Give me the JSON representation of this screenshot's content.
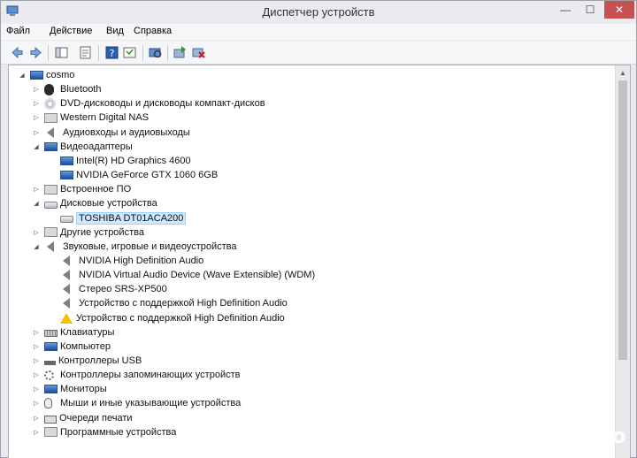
{
  "window": {
    "title": "Диспетчер устройств",
    "min_glyph": "—",
    "max_glyph": "☐",
    "close_glyph": "✕"
  },
  "menu": [
    "Файл",
    "Действие",
    "Вид",
    "Справка"
  ],
  "toolbar": [
    "back-icon",
    "forward-icon",
    "show-hide-tree-icon",
    "properties-icon",
    "help-icon",
    "action-icon",
    "scan-hardware-icon",
    "update-driver-icon",
    "uninstall-icon"
  ],
  "tree": [
    {
      "level": 0,
      "arrow": "◢",
      "icon": "computer-icon",
      "label": "cosmo"
    },
    {
      "level": 1,
      "arrow": "▷",
      "icon": "bluetooth-icon",
      "label": "Bluetooth"
    },
    {
      "level": 1,
      "arrow": "▷",
      "icon": "dvd-icon",
      "label": "DVD-дисководы и дисководы компакт-дисков"
    },
    {
      "level": 1,
      "arrow": "▷",
      "icon": "network-drive-icon",
      "label": "Western Digital NAS"
    },
    {
      "level": 1,
      "arrow": "▷",
      "icon": "speaker-icon",
      "label": "Аудиовходы и аудиовыходы"
    },
    {
      "level": 1,
      "arrow": "◢",
      "icon": "display-adapter-icon",
      "label": "Видеоадаптеры"
    },
    {
      "level": 2,
      "arrow": "",
      "icon": "display-adapter-icon",
      "label": "Intel(R) HD Graphics 4600"
    },
    {
      "level": 2,
      "arrow": "",
      "icon": "display-adapter-icon",
      "label": "NVIDIA GeForce GTX 1060 6GB"
    },
    {
      "level": 1,
      "arrow": "▷",
      "icon": "firmware-icon",
      "label": "Встроенное ПО"
    },
    {
      "level": 1,
      "arrow": "◢",
      "icon": "disk-icon",
      "label": "Дисковые устройства"
    },
    {
      "level": 2,
      "arrow": "",
      "icon": "disk-icon",
      "label": "TOSHIBA DT01ACA200",
      "selected": true
    },
    {
      "level": 1,
      "arrow": "▷",
      "icon": "other-devices-icon",
      "label": "Другие устройства"
    },
    {
      "level": 1,
      "arrow": "◢",
      "icon": "speaker-icon",
      "label": "Звуковые, игровые и видеоустройства"
    },
    {
      "level": 2,
      "arrow": "",
      "icon": "speaker-icon",
      "label": "NVIDIA High Definition Audio"
    },
    {
      "level": 2,
      "arrow": "",
      "icon": "speaker-icon",
      "label": "NVIDIA Virtual Audio Device (Wave Extensible) (WDM)"
    },
    {
      "level": 2,
      "arrow": "",
      "icon": "speaker-icon",
      "label": "Стерео SRS-XP500"
    },
    {
      "level": 2,
      "arrow": "",
      "icon": "speaker-icon",
      "label": "Устройство с поддержкой High Definition Audio"
    },
    {
      "level": 2,
      "arrow": "",
      "icon": "speaker-warning-icon",
      "label": "Устройство с поддержкой High Definition Audio"
    },
    {
      "level": 1,
      "arrow": "▷",
      "icon": "keyboard-icon",
      "label": "Клавиатуры"
    },
    {
      "level": 1,
      "arrow": "▷",
      "icon": "computer-icon",
      "label": "Компьютер"
    },
    {
      "level": 1,
      "arrow": "▷",
      "icon": "usb-icon",
      "label": "Контроллеры USB"
    },
    {
      "level": 1,
      "arrow": "▷",
      "icon": "storage-controller-icon",
      "label": "Контроллеры запоминающих устройств"
    },
    {
      "level": 1,
      "arrow": "▷",
      "icon": "monitor-icon",
      "label": "Мониторы"
    },
    {
      "level": 1,
      "arrow": "▷",
      "icon": "mouse-icon",
      "label": "Мыши и иные указывающие устройства"
    },
    {
      "level": 1,
      "arrow": "▷",
      "icon": "printer-icon",
      "label": "Очереди печати"
    },
    {
      "level": 1,
      "arrow": "▷",
      "icon": "software-device-icon",
      "label": "Программные устройства"
    }
  ],
  "watermark": {
    "text": "Avito"
  }
}
